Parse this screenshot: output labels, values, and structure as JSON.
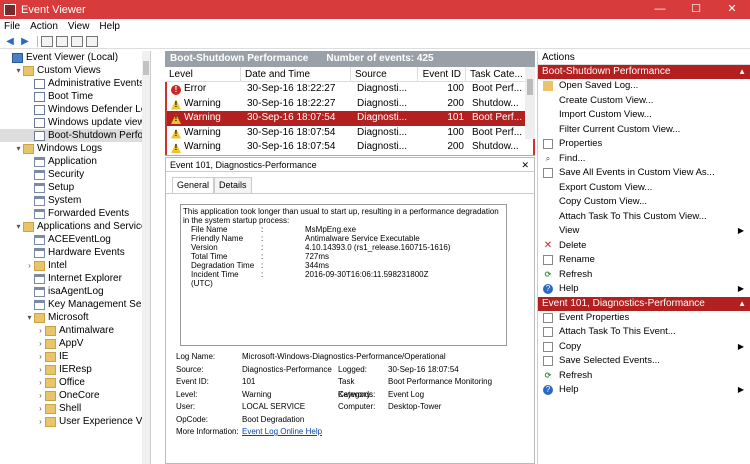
{
  "window": {
    "title": "Event Viewer",
    "minimize": "—",
    "maximize": "☐",
    "close": "✕"
  },
  "menu": [
    "File",
    "Action",
    "View",
    "Help"
  ],
  "tree": [
    {
      "label": "Event Viewer (Local)",
      "indent": 0,
      "exp": "",
      "icon": "ev"
    },
    {
      "label": "Custom Views",
      "indent": 1,
      "exp": "▾",
      "icon": "folder"
    },
    {
      "label": "Administrative Events",
      "indent": 2,
      "exp": "",
      "icon": "filter"
    },
    {
      "label": "Boot Time",
      "indent": 2,
      "exp": "",
      "icon": "filter"
    },
    {
      "label": "Windows Defender Logs",
      "indent": 2,
      "exp": "",
      "icon": "filter"
    },
    {
      "label": "Windows update view",
      "indent": 2,
      "exp": "",
      "icon": "filter"
    },
    {
      "label": "Boot-Shutdown Performar",
      "indent": 2,
      "exp": "",
      "icon": "filter",
      "selected": true
    },
    {
      "label": "Windows Logs",
      "indent": 1,
      "exp": "▾",
      "icon": "folder"
    },
    {
      "label": "Application",
      "indent": 2,
      "exp": "",
      "icon": "log"
    },
    {
      "label": "Security",
      "indent": 2,
      "exp": "",
      "icon": "log"
    },
    {
      "label": "Setup",
      "indent": 2,
      "exp": "",
      "icon": "log"
    },
    {
      "label": "System",
      "indent": 2,
      "exp": "",
      "icon": "log"
    },
    {
      "label": "Forwarded Events",
      "indent": 2,
      "exp": "",
      "icon": "log"
    },
    {
      "label": "Applications and Services Log",
      "indent": 1,
      "exp": "▾",
      "icon": "folder"
    },
    {
      "label": "ACEEventLog",
      "indent": 2,
      "exp": "",
      "icon": "log"
    },
    {
      "label": "Hardware Events",
      "indent": 2,
      "exp": "",
      "icon": "log"
    },
    {
      "label": "Intel",
      "indent": 2,
      "exp": "›",
      "icon": "folder"
    },
    {
      "label": "Internet Explorer",
      "indent": 2,
      "exp": "",
      "icon": "log"
    },
    {
      "label": "isaAgentLog",
      "indent": 2,
      "exp": "",
      "icon": "log"
    },
    {
      "label": "Key Management Service",
      "indent": 2,
      "exp": "",
      "icon": "log"
    },
    {
      "label": "Microsoft",
      "indent": 2,
      "exp": "▾",
      "icon": "folder"
    },
    {
      "label": "Antimalware",
      "indent": 3,
      "exp": "›",
      "icon": "folder"
    },
    {
      "label": "AppV",
      "indent": 3,
      "exp": "›",
      "icon": "folder"
    },
    {
      "label": "IE",
      "indent": 3,
      "exp": "›",
      "icon": "folder"
    },
    {
      "label": "IEResp",
      "indent": 3,
      "exp": "›",
      "icon": "folder"
    },
    {
      "label": "Office",
      "indent": 3,
      "exp": "›",
      "icon": "folder"
    },
    {
      "label": "OneCore",
      "indent": 3,
      "exp": "›",
      "icon": "folder"
    },
    {
      "label": "Shell",
      "indent": 3,
      "exp": "›",
      "icon": "folder"
    },
    {
      "label": "User Experience Virtuali",
      "indent": 3,
      "exp": "›",
      "icon": "folder"
    }
  ],
  "list": {
    "title": "Boot-Shutdown Performance",
    "count": "Number of events: 425",
    "columns": [
      "Level",
      "Date and Time",
      "Source",
      "Event ID",
      "Task Cate..."
    ],
    "rows": [
      {
        "level": "Error",
        "type": "error",
        "date": "30-Sep-16 18:22:27",
        "source": "Diagnosti...",
        "id": "100",
        "task": "Boot Perf..."
      },
      {
        "level": "Warning",
        "type": "warn",
        "date": "30-Sep-16 18:22:27",
        "source": "Diagnosti...",
        "id": "200",
        "task": "Shutdow..."
      },
      {
        "level": "Warning",
        "type": "warn",
        "date": "30-Sep-16 18:07:54",
        "source": "Diagnosti...",
        "id": "101",
        "task": "Boot Perf...",
        "selected": true
      },
      {
        "level": "Warning",
        "type": "warn",
        "date": "30-Sep-16 18:07:54",
        "source": "Diagnosti...",
        "id": "100",
        "task": "Boot Perf..."
      },
      {
        "level": "Warning",
        "type": "warn",
        "date": "30-Sep-16 18:07:54",
        "source": "Diagnosti...",
        "id": "200",
        "task": "Shutdow..."
      }
    ]
  },
  "detail": {
    "title": "Event 101, Diagnostics-Performance",
    "tabs": [
      "General",
      "Details"
    ],
    "description": "This application took longer than usual to start up, resulting in a performance degradation in the system startup process:",
    "fields": [
      {
        "k": "File Name",
        "v": "MsMpEng.exe"
      },
      {
        "k": "Friendly Name",
        "v": "Antimalware Service Executable"
      },
      {
        "k": "Version",
        "v": "4.10.14393.0 (rs1_release.160715-1616)"
      },
      {
        "k": "Total Time",
        "v": "727ms"
      },
      {
        "k": "Degradation Time",
        "v": "344ms"
      },
      {
        "k": "Incident Time (UTC)",
        "v": "2016-09-30T16:06:11.598231800Z"
      }
    ],
    "props": {
      "log_name_label": "Log Name:",
      "log_name": "Microsoft-Windows-Diagnostics-Performance/Operational",
      "source_label": "Source:",
      "source": "Diagnostics-Performance",
      "logged_label": "Logged:",
      "logged": "30-Sep-16 18:07:54",
      "event_id_label": "Event ID:",
      "event_id": "101",
      "task_label": "Task Category:",
      "task": "Boot Performance Monitoring",
      "level_label": "Level:",
      "level": "Warning",
      "keywords_label": "Keywords:",
      "keywords": "Event Log",
      "user_label": "User:",
      "user": "LOCAL SERVICE",
      "computer_label": "Computer:",
      "computer": "Desktop-Tower",
      "opcode_label": "OpCode:",
      "opcode": "Boot Degradation",
      "more_label": "More Information:",
      "more_link": "Event Log Online Help"
    }
  },
  "actions": {
    "title": "Actions",
    "section1": "Boot-Shutdown Performance",
    "items1": [
      {
        "label": "Open Saved Log...",
        "icon": "folder"
      },
      {
        "label": "Create Custom View...",
        "icon": "filter"
      },
      {
        "label": "Import Custom View...",
        "icon": "blank"
      },
      {
        "label": "Filter Current Custom View...",
        "icon": "filter"
      },
      {
        "label": "Properties",
        "icon": "doc"
      },
      {
        "label": "Find...",
        "icon": "find"
      },
      {
        "label": "Save All Events in Custom View As...",
        "icon": "doc"
      },
      {
        "label": "Export Custom View...",
        "icon": "blank"
      },
      {
        "label": "Copy Custom View...",
        "icon": "blank"
      },
      {
        "label": "Attach Task To This Custom View...",
        "icon": "blank"
      },
      {
        "label": "View",
        "icon": "blank",
        "sub": true
      },
      {
        "label": "Delete",
        "icon": "del"
      },
      {
        "label": "Rename",
        "icon": "doc"
      },
      {
        "label": "Refresh",
        "icon": "ref"
      },
      {
        "label": "Help",
        "icon": "help",
        "sub": true
      }
    ],
    "section2": "Event 101, Diagnostics-Performance",
    "items2": [
      {
        "label": "Event Properties",
        "icon": "doc"
      },
      {
        "label": "Attach Task To This Event...",
        "icon": "doc"
      },
      {
        "label": "Copy",
        "icon": "doc",
        "sub": true
      },
      {
        "label": "Save Selected Events...",
        "icon": "doc"
      },
      {
        "label": "Refresh",
        "icon": "ref"
      },
      {
        "label": "Help",
        "icon": "help",
        "sub": true
      }
    ]
  }
}
